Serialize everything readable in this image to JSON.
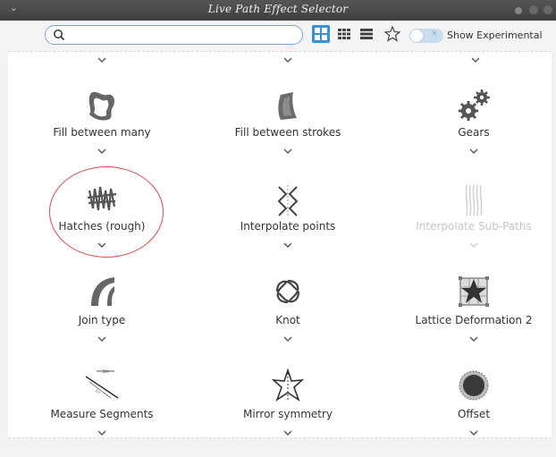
{
  "window": {
    "title": "Live Path Effect Selector"
  },
  "toolbar": {
    "search_value": "",
    "show_experimental_label": "Show Experimental"
  },
  "effects": [
    {
      "label": "Fill between many",
      "icon": "fill-between-many-icon",
      "enabled": true
    },
    {
      "label": "Fill between strokes",
      "icon": "fill-between-strokes-icon",
      "enabled": true
    },
    {
      "label": "Gears",
      "icon": "gears-icon",
      "enabled": true
    },
    {
      "label": "Hatches (rough)",
      "icon": "hatches-rough-icon",
      "enabled": true
    },
    {
      "label": "Interpolate points",
      "icon": "interpolate-points-icon",
      "enabled": true
    },
    {
      "label": "Interpolate Sub-Paths",
      "icon": "interpolate-sub-paths-icon",
      "enabled": false
    },
    {
      "label": "Join type",
      "icon": "join-type-icon",
      "enabled": true
    },
    {
      "label": "Knot",
      "icon": "knot-icon",
      "enabled": true
    },
    {
      "label": "Lattice Deformation 2",
      "icon": "lattice-deformation-icon",
      "enabled": true
    },
    {
      "label": "Measure Segments",
      "icon": "measure-segments-icon",
      "enabled": true
    },
    {
      "label": "Mirror symmetry",
      "icon": "mirror-symmetry-icon",
      "enabled": true
    },
    {
      "label": "Offset",
      "icon": "offset-icon",
      "enabled": true
    }
  ],
  "colors": {
    "accent": "#3b8fd8",
    "highlight_circle": "#d9494e",
    "icon_gray": "#666666"
  }
}
